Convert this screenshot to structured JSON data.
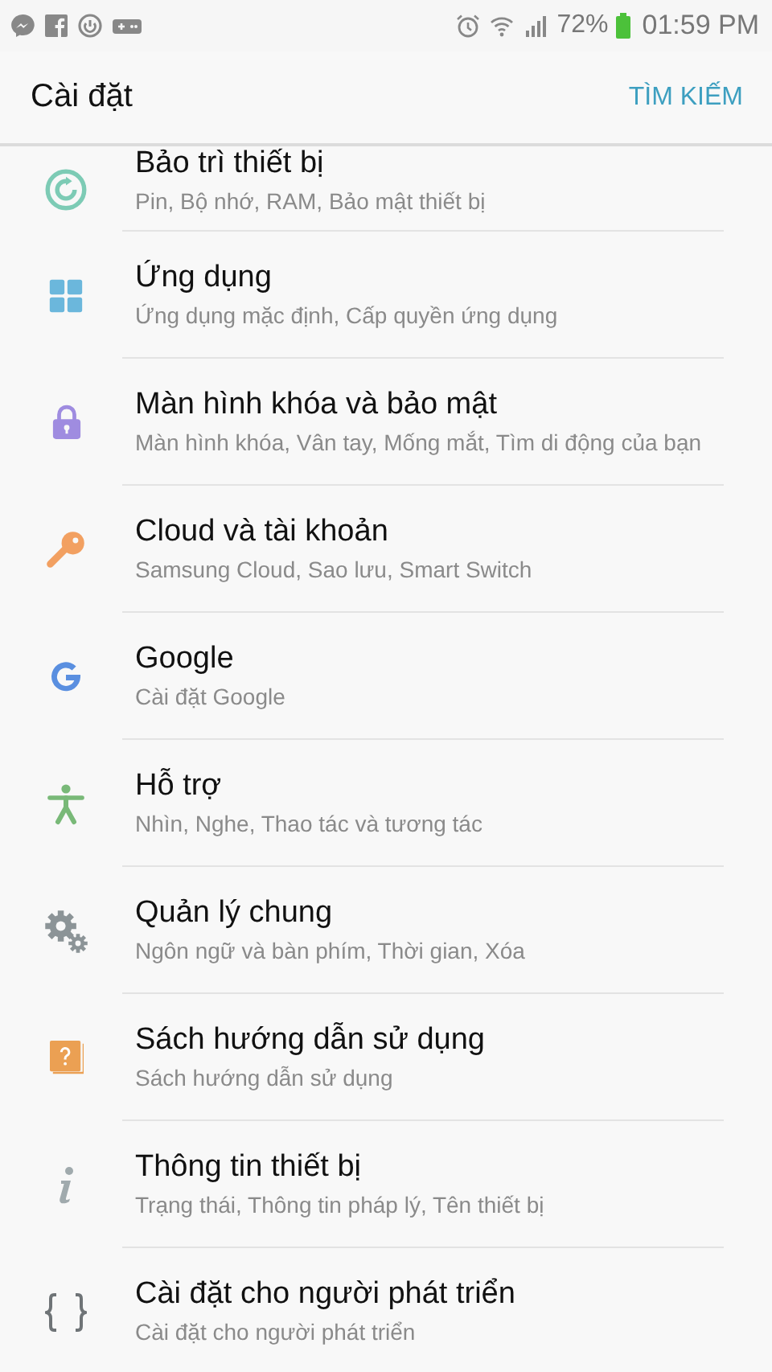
{
  "status_bar": {
    "battery": "72%",
    "time": "01:59 PM"
  },
  "header": {
    "title": "Cài đặt",
    "action": "TÌM KIẾM"
  },
  "items": [
    {
      "title": "Bảo trì thiết bị",
      "subtitle": "Pin, Bộ nhớ, RAM, Bảo mật thiết bị"
    },
    {
      "title": "Ứng dụng",
      "subtitle": "Ứng dụng mặc định, Cấp quyền ứng dụng"
    },
    {
      "title": "Màn hình khóa và bảo mật",
      "subtitle": "Màn hình khóa, Vân tay, Mống mắt, Tìm di động của bạn"
    },
    {
      "title": "Cloud và tài khoản",
      "subtitle": "Samsung Cloud, Sao lưu, Smart Switch"
    },
    {
      "title": "Google",
      "subtitle": "Cài đặt Google"
    },
    {
      "title": "Hỗ trợ",
      "subtitle": "Nhìn, Nghe, Thao tác và tương tác"
    },
    {
      "title": "Quản lý chung",
      "subtitle": "Ngôn ngữ và bàn phím, Thời gian, Xóa"
    },
    {
      "title": "Sách hướng dẫn sử dụng",
      "subtitle": "Sách hướng dẫn sử dụng"
    },
    {
      "title": "Thông tin thiết bị",
      "subtitle": "Trạng thái, Thông tin pháp lý, Tên thiết bị"
    },
    {
      "title": "Cài đặt cho người phát triển",
      "subtitle": "Cài đặt cho người phát triển"
    }
  ]
}
